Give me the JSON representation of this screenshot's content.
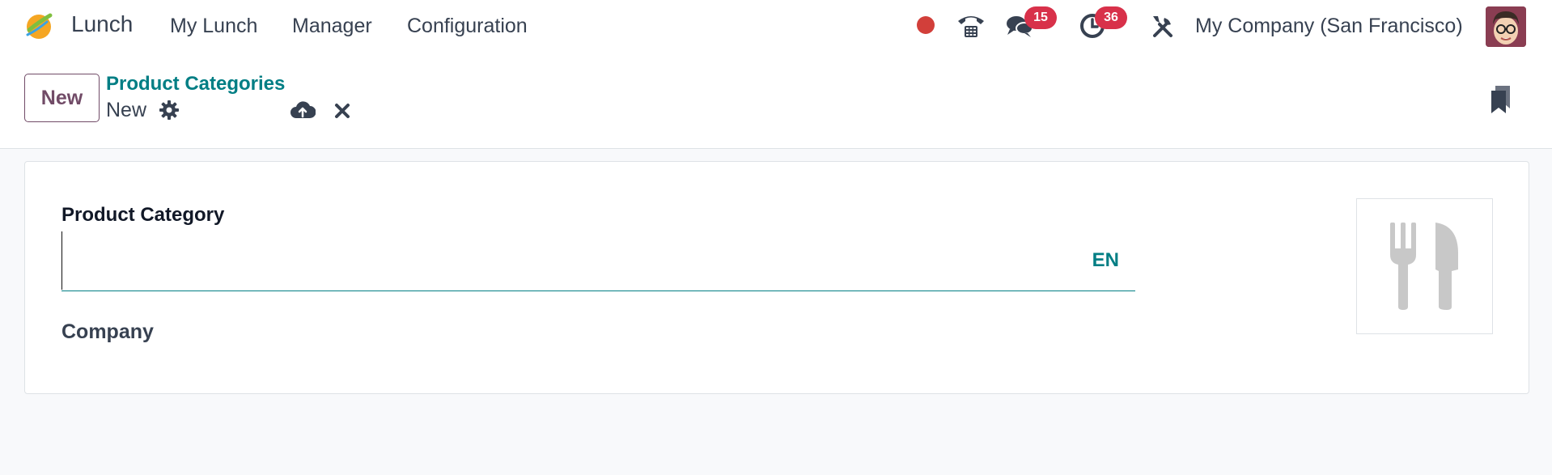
{
  "navbar": {
    "app_name": "Lunch",
    "menu": [
      "My Lunch",
      "Manager",
      "Configuration"
    ],
    "messages_count": "15",
    "activities_count": "36",
    "company": "My Company (San Francisco)",
    "icons": [
      "lunch-app-icon",
      "record-dot",
      "phone-icon",
      "chat-icon",
      "clock-icon",
      "tools-icon",
      "avatar"
    ]
  },
  "control_panel": {
    "new_label": "New",
    "breadcrumb_parent": "Product Categories",
    "breadcrumb_current": "New",
    "icons": [
      "gear-icon",
      "cloud-upload-icon",
      "close-icon",
      "bookmark-icon"
    ]
  },
  "form": {
    "category_label": "Product Category",
    "category_value": "",
    "lang": "EN",
    "company_label": "Company",
    "image_placeholder_icon": "fork-knife-icon"
  },
  "colors": {
    "accent": "#017e84",
    "brand": "#714b67",
    "badge": "#d8314a",
    "record": "#d23f3a"
  }
}
